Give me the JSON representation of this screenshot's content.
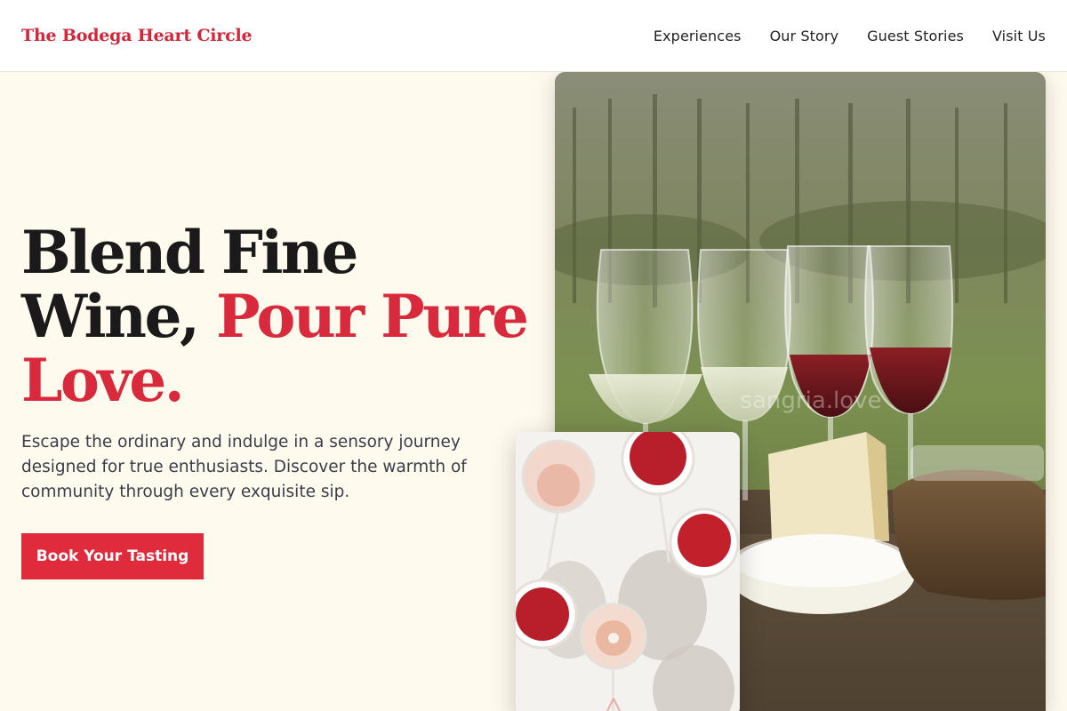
{
  "header": {
    "brand": "The Bodega Heart Circle",
    "nav": [
      {
        "label": "Experiences"
      },
      {
        "label": "Our Story"
      },
      {
        "label": "Guest Stories"
      },
      {
        "label": "Visit Us"
      }
    ]
  },
  "hero": {
    "title_part1": "Blend Fine",
    "title_part2": "Wine, ",
    "title_accent": "Pour Pure Love.",
    "description": "Escape the ordinary and indulge in a sensory journey designed for true enthusiasts. Discover the warmth of community through every exquisite sip.",
    "cta_label": "Book Your Tasting",
    "watermark": "sangria.love"
  },
  "colors": {
    "accent": "#d82a3c",
    "button": "#e02b3d",
    "background": "#fffaee",
    "text": "#1a1a1a"
  }
}
